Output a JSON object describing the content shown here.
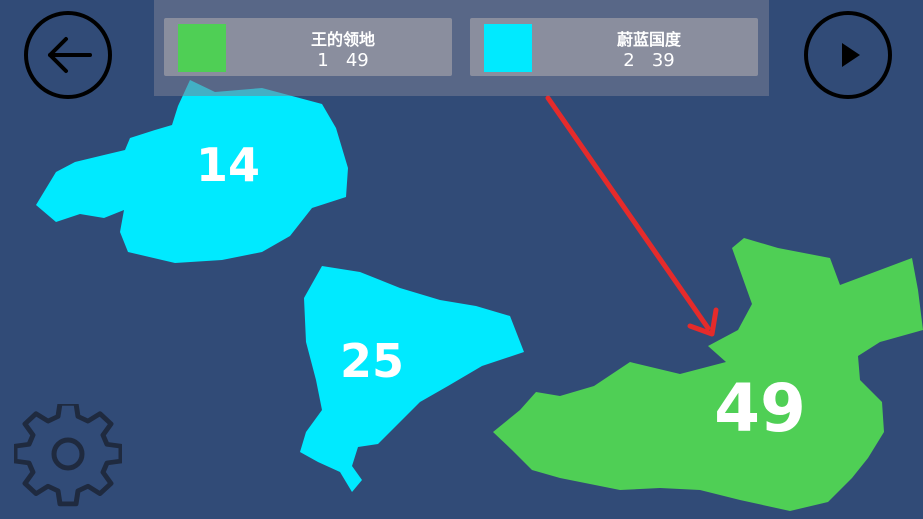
{
  "colors": {
    "background": "#314b77",
    "player_green": "#4fcf55",
    "player_cyan": "#00eaff",
    "arrow": "#e52b2b"
  },
  "players": [
    {
      "name": "王的领地",
      "rank": "1",
      "score": "49",
      "color": "#4fcf55"
    },
    {
      "name": "蔚蓝国度",
      "rank": "2",
      "score": "39",
      "color": "#00eaff"
    }
  ],
  "territories": [
    {
      "owner": "蔚蓝国度",
      "troops": "14"
    },
    {
      "owner": "蔚蓝国度",
      "troops": "25"
    },
    {
      "owner": "王的领地",
      "troops": "49"
    }
  ],
  "controls": {
    "back_icon": "arrow-left-icon",
    "next_icon": "play-icon",
    "settings_icon": "gear-icon"
  }
}
